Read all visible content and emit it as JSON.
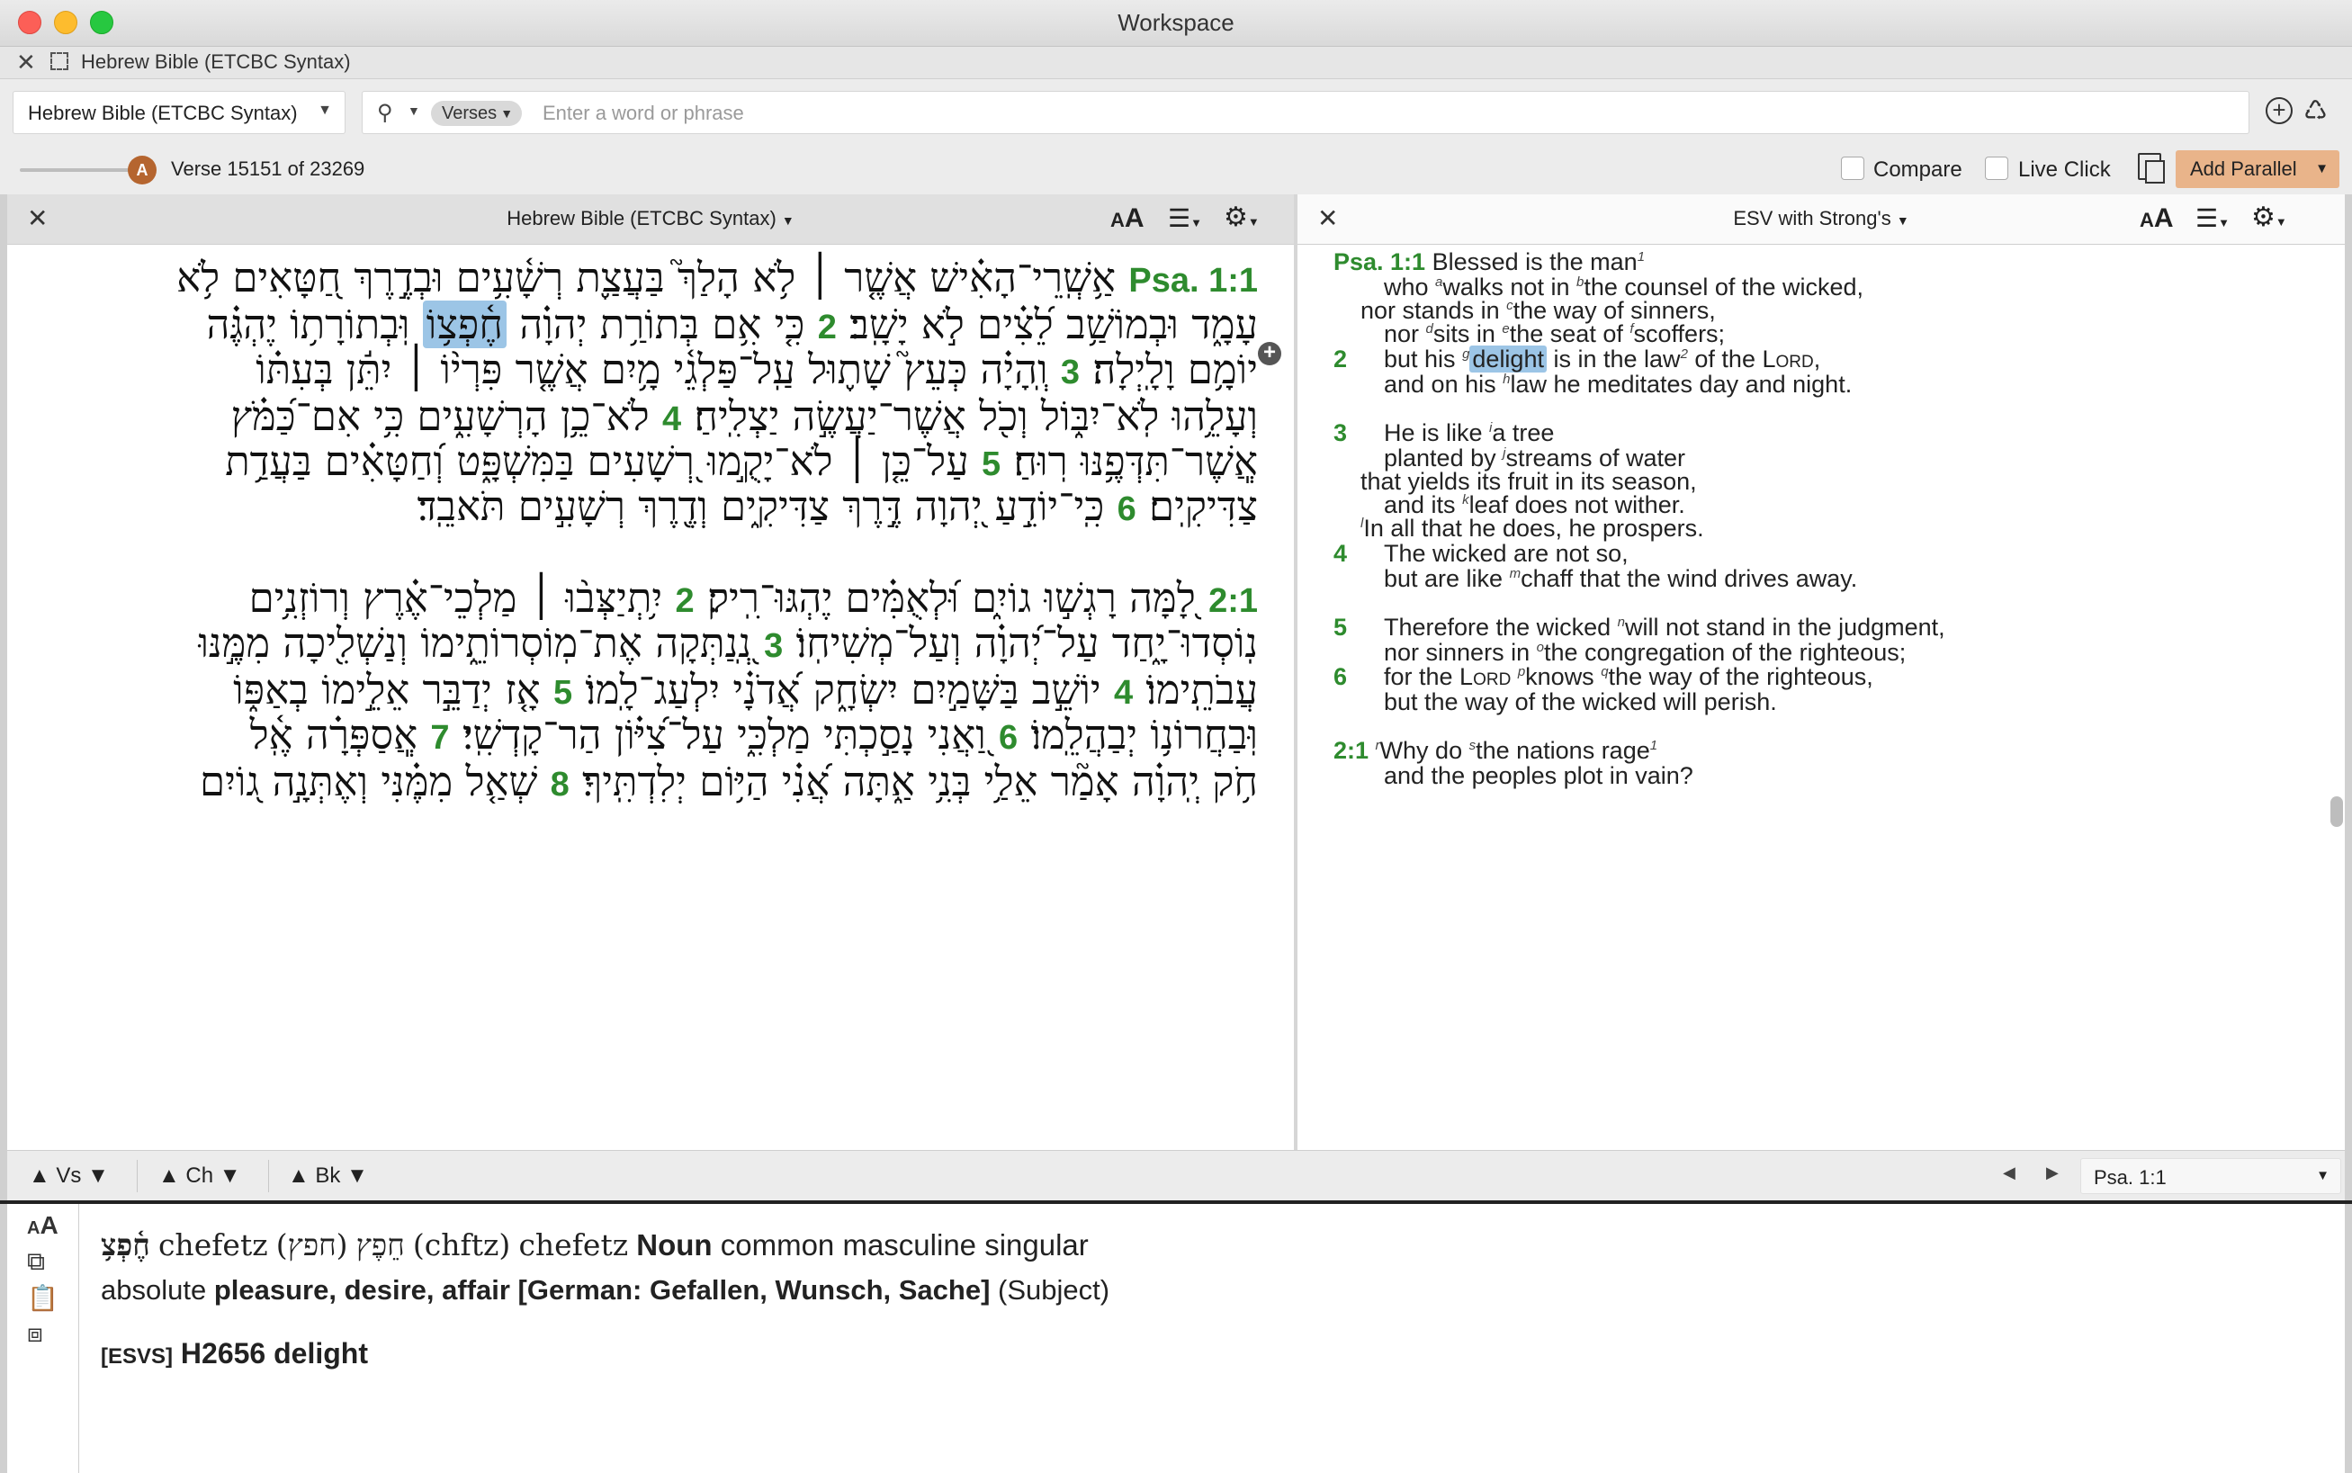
{
  "window": {
    "title": "Workspace"
  },
  "tab": {
    "title": "Hebrew Bible (ETCBC Syntax)"
  },
  "toolbar": {
    "resource": "Hebrew Bible (ETCBC Syntax)",
    "scope": "Verses",
    "search_placeholder": "Enter a word or phrase"
  },
  "status": {
    "slider_badge": "A",
    "verse_counter": "Verse 15151 of 23269",
    "compare": "Compare",
    "live_click": "Live Click",
    "add_parallel": "Add Parallel"
  },
  "left_panel": {
    "title": "Hebrew Bible (ETCBC Syntax)",
    "font_size_icon": "AA",
    "lines": [
      {
        "pre": "",
        "ref": "Psa. 1:1",
        "text": " אַ֥שְֽׁרֵי־הָאִ֗ישׁ אֲשֶׁ֤ר ׀ לֹ֥א הָלַךְ֮ בַּעֲצַ֪ת רְשָׁ֫עִ֥ים וּבְדֶ֣רֶךְ חַ֭טָּאִים לֹ֥א",
        "hl": "",
        "post": ""
      },
      {
        "pre": "עָמָ֑ד וּבְמוֹשַׁ֥ב לֵ֝צִ֗ים לֹ֣א יָשָֽׁב׃ ",
        "ref": "2",
        "text": " כִּ֤י אִ֥ם בְּתוֹרַ֥ת יְהוָ֗ה ",
        "hl": "חֶ֫פְצ֥וֹ",
        "post": " וּֽבְתוֹרָת֥וֹ יֶהְגֶּ֗ה"
      },
      {
        "pre": "יוֹמָ֥ם וָלָֽיְלָה׃ ",
        "ref": "3",
        "text": " וְֽהָיָ֗ה כְּעֵץ֮ שָׁת֪וּל עַֽל־פַּלְגֵ֫י מָ֥יִם אֲשֶׁ֤ר פִּרְי֨וֹ ׀ יִתֵּ֬ן בְּעִתּ֗וֹ",
        "hl": "",
        "post": ""
      },
      {
        "pre": "וְעָלֵ֥הוּ לֹֽא־יִבּ֑וֹל וְכֹ֖ל אֲשֶׁר־יַעֲשֶׂ֣ה יַצְלִֽיחַ׃ ",
        "ref": "4",
        "text": " לֹא־כֵ֥ן הָרְשָׁעִ֑ים כִּ֥י אִם־כַּ֝מֹּ֗ץ",
        "hl": "",
        "post": ""
      },
      {
        "pre": "אֲ‍ֽשֶׁר־תִּדְּפֶ֥נּוּ רֽוּחַ׃ ",
        "ref": "5",
        "text": " עַל־כֵּ֤ן ׀ לֹא־יָקֻ֣מוּ רְ֭שָׁעִים בַּמִּשְׁפָּ֑ט וְ֝חַטָּאִ֗ים בַּעֲדַ֥ת",
        "hl": "",
        "post": ""
      },
      {
        "pre": "צַדִּיקִֽים׃ ",
        "ref": "6",
        "text": " כִּֽי־יוֹדֵ֣עַ יְ֭הוָה דֶּ֣רֶךְ צַדִּיקִ֑ים וְדֶ֖רֶךְ רְשָׁעִ֣ים תֹּאבֵֽד׃",
        "hl": "",
        "post": ""
      },
      {
        "pre": "",
        "ref": "2:1",
        "text": " לָ֭מָּה רָגְשׁ֣וּ גוֹיִ֑ם וּ֝לְאֻמִּ֗ים יֶהְגּוּ־רִֽיק׃ ",
        "hl": "",
        "post": "",
        "ref2": "2",
        "text2": " יִ֥תְיַצְּב֨וּ ׀ מַלְכֵי־אֶ֗רֶץ וְרוֹזְנִ֥ים"
      },
      {
        "pre": "נֽוֹסְדוּ־יָ֑חַד עַל־יְ֝הוָ֗ה וְעַל־מְשִׁיחֽוֹ׃ ",
        "ref": "3",
        "text": " נְֽ֭נַתְּקָה אֶת־מֽוֹסְרוֹתֵ֑ימוֹ וְנַשְׁלִ֖יכָה מִמֶּ֣נּוּ",
        "hl": "",
        "post": ""
      },
      {
        "pre": "עֲבֹתֵֽימוֹ׃ ",
        "ref": "4",
        "text": " יוֹשֵׁ֣ב בַּשָּׁמַ֣יִם יִשְׂחָ֑ק אֲ֝דֹנָ֗י יִלְעַג־לָֽמוֹ׃ ",
        "hl": "",
        "post": "",
        "ref2": "5",
        "text2": " אָ֤ז יְדַבֵּ֣ר אֵלֵ֣ימוֹ בְאַפּ֑וֹ"
      },
      {
        "pre": "וּֽבַחֲרוֹנ֥וֹ יְבַהֲלֵֽמוֹ׃ ",
        "ref": "6",
        "text": " וַ֭אֲנִי נָסַ֣כְתִּי מַלְכִּ֑י עַל־צִ֝יּ֗וֹן הַר־קָדְשִֽׁי׃ ",
        "hl": "",
        "post": "",
        "ref2": "7",
        "text2": " אֲֽסַפְּרָ֗ה אֶֽ֫ל"
      },
      {
        "pre": "חֹ֥ק יְֽהוָ֗ה אָמַ֘ר אֵלַ֥י בְּנִ֥י אַ֑תָּה אֲ֝נִ֗י הַיּ֥וֹם יְלִדְתִּֽיךָ׃ ",
        "ref": "8",
        "text": " שְׁאַ֤ל מִמֶּ֗נִּי וְאֶתְּנָ֣ה ג֭וֹיִם",
        "hl": "",
        "post": ""
      }
    ]
  },
  "right_panel": {
    "title": "ESV with Strong's",
    "font_size_icon": "AA",
    "lines": [
      {
        "ref": "Psa. 1:1",
        "text": " Blessed is the man",
        "sup": "1",
        "rest": ""
      },
      {
        "ref": "",
        "text": "who ",
        "sup": "a",
        "rest": "walks not in ",
        "sup2": "b",
        "rest2": "the counsel of the wicked,"
      },
      {
        "ref": "",
        "text": "nor stands in ",
        "sup": "c",
        "rest": "the way of sinners,"
      },
      {
        "ref": "",
        "text": "nor ",
        "sup": "d",
        "rest": "sits in ",
        "sup2": "e",
        "rest2": "the seat of ",
        "sup3": "f",
        "rest3": "scoffers;"
      },
      {
        "ref": "2",
        "text": "but his ",
        "sup": "g",
        "hl": "delight",
        "rest": " is in the law",
        "sup2": "2",
        "rest2": " of the ",
        "lord": "Lord",
        "rest3": ","
      },
      {
        "ref": "",
        "text": "and on his ",
        "sup": "h",
        "rest": "law he meditates day and night."
      },
      {
        "ref": "3",
        "text": "He is like ",
        "sup": "i",
        "rest": "a tree"
      },
      {
        "ref": "",
        "text": "planted by ",
        "sup": "j",
        "rest": "streams of water"
      },
      {
        "ref": "",
        "text": "that yields its fruit in its season,",
        "sup": "",
        "rest": ""
      },
      {
        "ref": "",
        "text": "and its ",
        "sup": "k",
        "rest": "leaf does not wither."
      },
      {
        "ref": "",
        "text": "",
        "sup": "l",
        "rest": "In all that he does, he prospers."
      },
      {
        "ref": "4",
        "text": "The wicked are not so,",
        "sup": "",
        "rest": ""
      },
      {
        "ref": "",
        "text": "but are like ",
        "sup": "m",
        "rest": "chaff that the wind drives away."
      },
      {
        "ref": "5",
        "text": "Therefore the wicked ",
        "sup": "n",
        "rest": "will not stand in the judgment,"
      },
      {
        "ref": "",
        "text": "nor sinners in ",
        "sup": "o",
        "rest": "the congregation of the righteous;"
      },
      {
        "ref": "6",
        "text": "for the ",
        "lord": "Lord",
        "sup": "p",
        "rest": "knows ",
        "sup2": "q",
        "rest2": "the way of the righteous,"
      },
      {
        "ref": "",
        "text": "but the way of the wicked will perish.",
        "sup": "",
        "rest": ""
      },
      {
        "ref": "2:1",
        "text": " ",
        "sup": "r",
        "rest": "Why do ",
        "sup2": "s",
        "rest2": "the nations rage",
        "sup3": "1",
        "rest3": ""
      },
      {
        "ref": "",
        "text": "and the peoples plot in vain?",
        "sup": "",
        "rest": ""
      }
    ]
  },
  "navbar": {
    "verse": "Vs",
    "chapter": "Ch",
    "book": "Bk",
    "reference": "Psa. 1:1"
  },
  "info": {
    "hebrew_word": "חֶ֫פְצ֥",
    "translit": "chefetz",
    "lemma_pointed": "חֵפֶץ",
    "lemma_unpointed": "(חפץ)",
    "lemma_translit": "(chftz)",
    "lemma_name": "chefetz",
    "pos": "Noun",
    "morph": "common masculine singular",
    "morph2": "absolute",
    "gloss": "pleasure, desire, affair [German: Gefallen, Wunsch, Sache]",
    "role": "(Subject)",
    "strongs_tag": "[ESVS]",
    "strongs_num": "H2656",
    "strongs_word": "delight"
  },
  "colors": {
    "verse_green": "#2e8b2e",
    "highlight": "#9cc5e6",
    "add_parallel_bg": "#e9b48a",
    "slider_badge": "#b5652f"
  }
}
